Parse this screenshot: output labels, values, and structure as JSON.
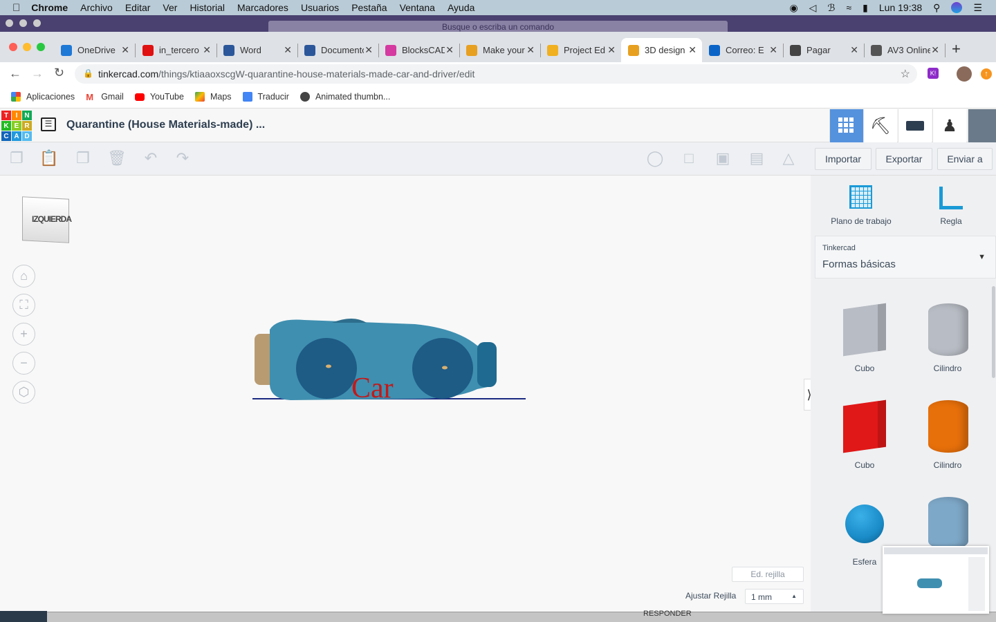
{
  "menubar": {
    "app": "Chrome",
    "items": [
      "Archivo",
      "Editar",
      "Ver",
      "Historial",
      "Marcadores",
      "Usuarios",
      "Pestaña",
      "Ventana",
      "Ayuda"
    ],
    "clock": "Lun 19:38"
  },
  "window": {
    "search_placeholder": "Busque o escriba un comando"
  },
  "tabs": [
    {
      "label": "OneDrive",
      "color": "#1e78d6"
    },
    {
      "label": "in_tercero",
      "color": "#e01010"
    },
    {
      "label": "Word",
      "color": "#2b579a"
    },
    {
      "label": "Documento",
      "color": "#2b579a"
    },
    {
      "label": "BlocksCAD",
      "color": "#d43aa0"
    },
    {
      "label": "Make your",
      "color": "#e8a020"
    },
    {
      "label": "Project Ed",
      "color": "#f0b020"
    },
    {
      "label": "3D design",
      "color": "#e8a020",
      "active": true
    },
    {
      "label": "Correo: E",
      "color": "#0a64c8"
    },
    {
      "label": "Pagar",
      "color": "#444444"
    },
    {
      "label": "AV3 Online",
      "color": "#555555"
    }
  ],
  "address": {
    "domain": "tinkercad.com",
    "path": "/things/ktiaaoxscgW-quarantine-house-materials-made-car-and-driver/edit"
  },
  "bookmarks": [
    "Aplicaciones",
    "Gmail",
    "YouTube",
    "Maps",
    "Traducir",
    "Animated thumbn..."
  ],
  "tinkercad": {
    "logo_letters": [
      "T",
      "I",
      "N",
      "K",
      "E",
      "R",
      "C",
      "A",
      "D"
    ],
    "title": "Quarantine (House Materials-made) ...",
    "buttons": {
      "import": "Importar",
      "export": "Exportar",
      "send": "Enviar a"
    },
    "viewcube": "IZQUIERDA",
    "model_text": "Car",
    "panel": {
      "workplane": "Plano de trabajo",
      "ruler": "Regla",
      "library_source": "Tinkercad",
      "library": "Formas básicas",
      "shapes": [
        {
          "label": "Cubo",
          "color": "#b8bcc4"
        },
        {
          "label": "Cilindro",
          "color": "#b8bcc4"
        },
        {
          "label": "Cubo",
          "color": "#e01818"
        },
        {
          "label": "Cilindro",
          "color": "#e8700a"
        },
        {
          "label": "Esfera",
          "color": "#1a8cc8"
        },
        {
          "label": "",
          "color": "#7ea8c8"
        }
      ]
    },
    "grid": {
      "edit_label": "Ed. rejilla",
      "snap_label": "Ajustar Rejilla",
      "snap_value": "1 mm"
    }
  },
  "dock": {
    "partial_text": "RESPONDER"
  }
}
